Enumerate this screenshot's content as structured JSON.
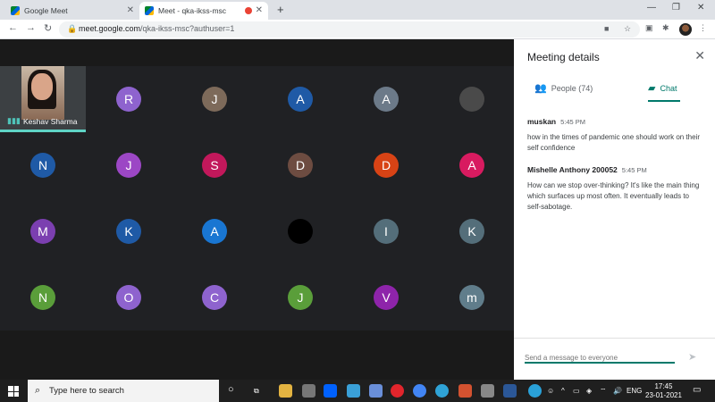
{
  "browser": {
    "tabs": [
      {
        "label": "Google Meet"
      },
      {
        "label": "Meet - qka-ikss-msc"
      }
    ],
    "url_host": "meet.google.com",
    "url_path": "/qka-ikss-msc?authuser=1"
  },
  "meeting": {
    "self_name": "Keshav Sharma",
    "participants": [
      {
        "initial": "R",
        "color": "#8e63ce"
      },
      {
        "initial": "J",
        "color": "#7d6a5a"
      },
      {
        "initial": "A",
        "color": "#1f5aa6"
      },
      {
        "initial": "A",
        "color": "#6c7a89"
      },
      {
        "initial": "",
        "color": "#4a4a4a"
      },
      {
        "initial": "N",
        "color": "#1f5aa6"
      },
      {
        "initial": "J",
        "color": "#9c47c5"
      },
      {
        "initial": "S",
        "color": "#c2185b"
      },
      {
        "initial": "D",
        "color": "#6d4c41"
      },
      {
        "initial": "D",
        "color": "#d84315"
      },
      {
        "initial": "A",
        "color": "#d81b60"
      },
      {
        "initial": "M",
        "color": "#7b3fb0"
      },
      {
        "initial": "K",
        "color": "#1f5aa6"
      },
      {
        "initial": "A",
        "color": "#1976d2"
      },
      {
        "initial": "",
        "color": "#000000"
      },
      {
        "initial": "I",
        "color": "#546e7a"
      },
      {
        "initial": "K",
        "color": "#546e7a"
      },
      {
        "initial": "N",
        "color": "#5a9e3a"
      },
      {
        "initial": "O",
        "color": "#8e63ce"
      },
      {
        "initial": "C",
        "color": "#8e63ce"
      },
      {
        "initial": "J",
        "color": "#5a9e3a"
      },
      {
        "initial": "V",
        "color": "#8e24aa"
      },
      {
        "initial": "m",
        "color": "#607d8b"
      }
    ]
  },
  "panel": {
    "title": "Meeting details",
    "people_tab": "People (74)",
    "chat_tab": "Chat",
    "messages": [
      {
        "sender": "muskan",
        "time": "5:45 PM",
        "text": "how in the times of pandemic one should work on their self confidence"
      },
      {
        "sender": "Mishelle Anthony 200052",
        "time": "5:45 PM",
        "text": "How can we stop over-thinking? It's like the main thing which surfaces up most often. It eventually leads to self-sabotage."
      }
    ],
    "input_placeholder": "Send a message to everyone"
  },
  "taskbar": {
    "search_placeholder": "Type here to search",
    "language": "ENG",
    "time": "17:45",
    "date": "23-01-2021"
  },
  "colors": {
    "accent": "#00796b",
    "meet_bg": "#202124"
  }
}
